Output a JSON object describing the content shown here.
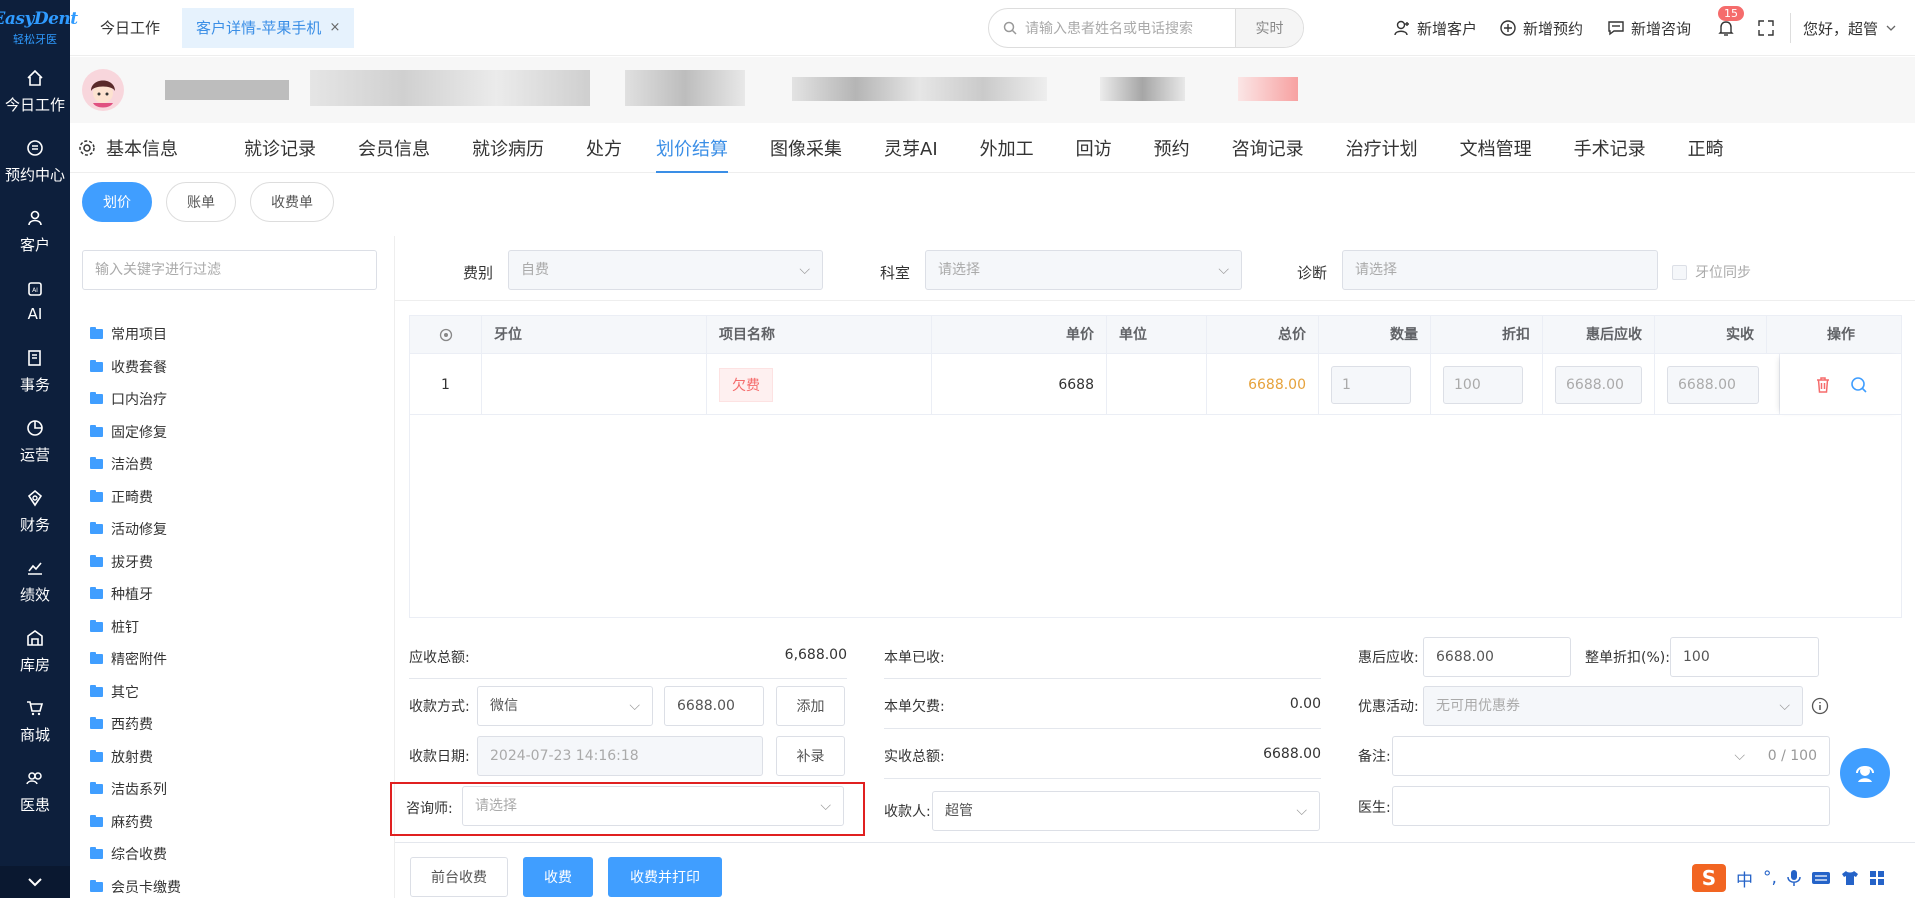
{
  "logo": {
    "line1": "EasyDent",
    "line2": "轻松牙医"
  },
  "nav": {
    "items": [
      {
        "label": "今日工作",
        "icon": "home-icon"
      },
      {
        "label": "预约中心",
        "icon": "appointment-icon"
      },
      {
        "label": "客户",
        "icon": "customer-icon"
      },
      {
        "label": "AI",
        "icon": "ai-icon"
      },
      {
        "label": "事务",
        "icon": "task-icon"
      },
      {
        "label": "运营",
        "icon": "operation-icon"
      },
      {
        "label": "财务",
        "icon": "finance-icon"
      },
      {
        "label": "绩效",
        "icon": "performance-icon"
      },
      {
        "label": "库房",
        "icon": "warehouse-icon"
      },
      {
        "label": "商城",
        "icon": "mall-icon"
      },
      {
        "label": "医患",
        "icon": "doctor-patient-icon"
      }
    ]
  },
  "topbar": {
    "tab_today": "今日工作",
    "tab_active": "客户详情-苹果手机",
    "tab_close": "×",
    "search_placeholder": "请输入患者姓名或电话搜索",
    "search_mode": "实时",
    "add_customer": "新增客户",
    "add_appointment": "新增预约",
    "add_consult": "新增咨询",
    "notification_count": "15",
    "greeting": "您好，超管"
  },
  "subtabs": [
    "基本信息",
    "就诊记录",
    "会员信息",
    "就诊病历",
    "处方",
    "划价结算",
    "图像采集",
    "灵芽AI",
    "外加工",
    "回访",
    "预约",
    "咨询记录",
    "治疗计划",
    "文档管理",
    "手术记录",
    "正畸"
  ],
  "active_subtab": "划价结算",
  "pills": {
    "p1": "划价",
    "p2": "账单",
    "p3": "收费单"
  },
  "sidebar": {
    "filter_placeholder": "输入关键字进行过滤",
    "tree": [
      "常用项目",
      "收费套餐",
      "口内治疗",
      "固定修复",
      "洁治费",
      "正畸费",
      "活动修复",
      "拔牙费",
      "种植牙",
      "桩钉",
      "精密附件",
      "其它",
      "西药费",
      "放射费",
      "洁齿系列",
      "麻药费",
      "综合收费",
      "会员卡缴费"
    ]
  },
  "filters": {
    "fee_type_label": "费别",
    "fee_type_value": "自费",
    "dept_label": "科室",
    "dept_placeholder": "请选择",
    "diag_label": "诊断",
    "diag_placeholder": "请选择",
    "tooth_sync": "牙位同步"
  },
  "table": {
    "headers": {
      "tooth": "牙位",
      "item": "项目名称",
      "price": "单价",
      "unit": "单位",
      "total": "总价",
      "qty": "数量",
      "discount": "折扣",
      "after": "惠后应收",
      "actual": "实收",
      "ops": "操作"
    },
    "rows": [
      {
        "no": "1",
        "tooth": "",
        "item": "欠费",
        "price": "6688",
        "unit": "",
        "total": "6688.00",
        "qty": "1",
        "discount": "100",
        "after": "6688.00",
        "actual": "6688.00"
      }
    ]
  },
  "summary": {
    "receivable_label": "应收总额:",
    "receivable_value": "6,688.00",
    "paid_label": "本单已收:",
    "paid_value": "",
    "after_label": "惠后应收:",
    "after_value": "6688.00",
    "whole_discount_label": "整单折扣(%):",
    "whole_discount_value": "100",
    "pay_method_label": "收款方式:",
    "pay_method_value": "微信",
    "pay_amount": "6688.00",
    "add_btn": "添加",
    "owed_label": "本单欠费:",
    "owed_value": "0.00",
    "promo_label": "优惠活动:",
    "promo_placeholder": "无可用优惠券",
    "date_label": "收款日期:",
    "date_value": "2024-07-23 14:16:18",
    "supplement_btn": "补录",
    "actual_label": "实收总额:",
    "actual_value": "6688.00",
    "remark_label": "备注:",
    "remark_count": "0 / 100",
    "consultant_label": "咨询师:",
    "consultant_placeholder": "请选择",
    "cashier_label": "收款人:",
    "cashier_value": "超管",
    "doctor_label": "医生:"
  },
  "actions": {
    "front_desk": "前台收费",
    "charge": "收费",
    "charge_print": "收费并打印"
  },
  "ime": {
    "lang": "中"
  }
}
